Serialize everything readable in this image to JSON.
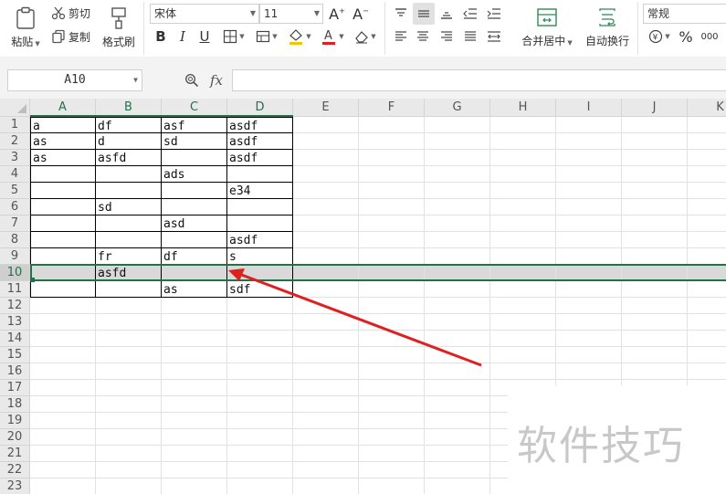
{
  "ribbon": {
    "paste": "粘贴",
    "cut": "剪切",
    "copy": "复制",
    "format_painter": "格式刷",
    "font_name": "宋体",
    "font_size": "11",
    "merge_center": "合并居中",
    "wrap_text": "自动换行",
    "number_format": "常规"
  },
  "formula_bar": {
    "name_box": "A10",
    "fx": "fx",
    "formula": ""
  },
  "columns": [
    "A",
    "B",
    "C",
    "D",
    "E",
    "F",
    "G",
    "H",
    "I",
    "J",
    "K"
  ],
  "rows": [
    "1",
    "2",
    "3",
    "4",
    "5",
    "6",
    "7",
    "8",
    "9",
    "10",
    "11",
    "12",
    "13",
    "14",
    "15",
    "16",
    "17",
    "18",
    "19",
    "20",
    "21",
    "22",
    "23"
  ],
  "cells": [
    [
      "a",
      "df",
      "asf",
      "asdf"
    ],
    [
      "as",
      "d",
      "sd",
      "asdf"
    ],
    [
      "as",
      "asfd",
      "",
      "asdf"
    ],
    [
      "",
      "",
      "ads",
      ""
    ],
    [
      "",
      "",
      "",
      "e34"
    ],
    [
      "",
      "sd",
      "",
      ""
    ],
    [
      "",
      "",
      "asd",
      ""
    ],
    [
      "",
      "",
      "",
      "asdf"
    ],
    [
      "",
      "fr",
      "df",
      "s"
    ],
    [
      "",
      "asfd",
      "",
      ""
    ],
    [
      "",
      "",
      "as",
      "sdf"
    ]
  ],
  "watermark": "软件技巧",
  "colors": {
    "accent": "#217346",
    "arrow": "#e02020"
  }
}
